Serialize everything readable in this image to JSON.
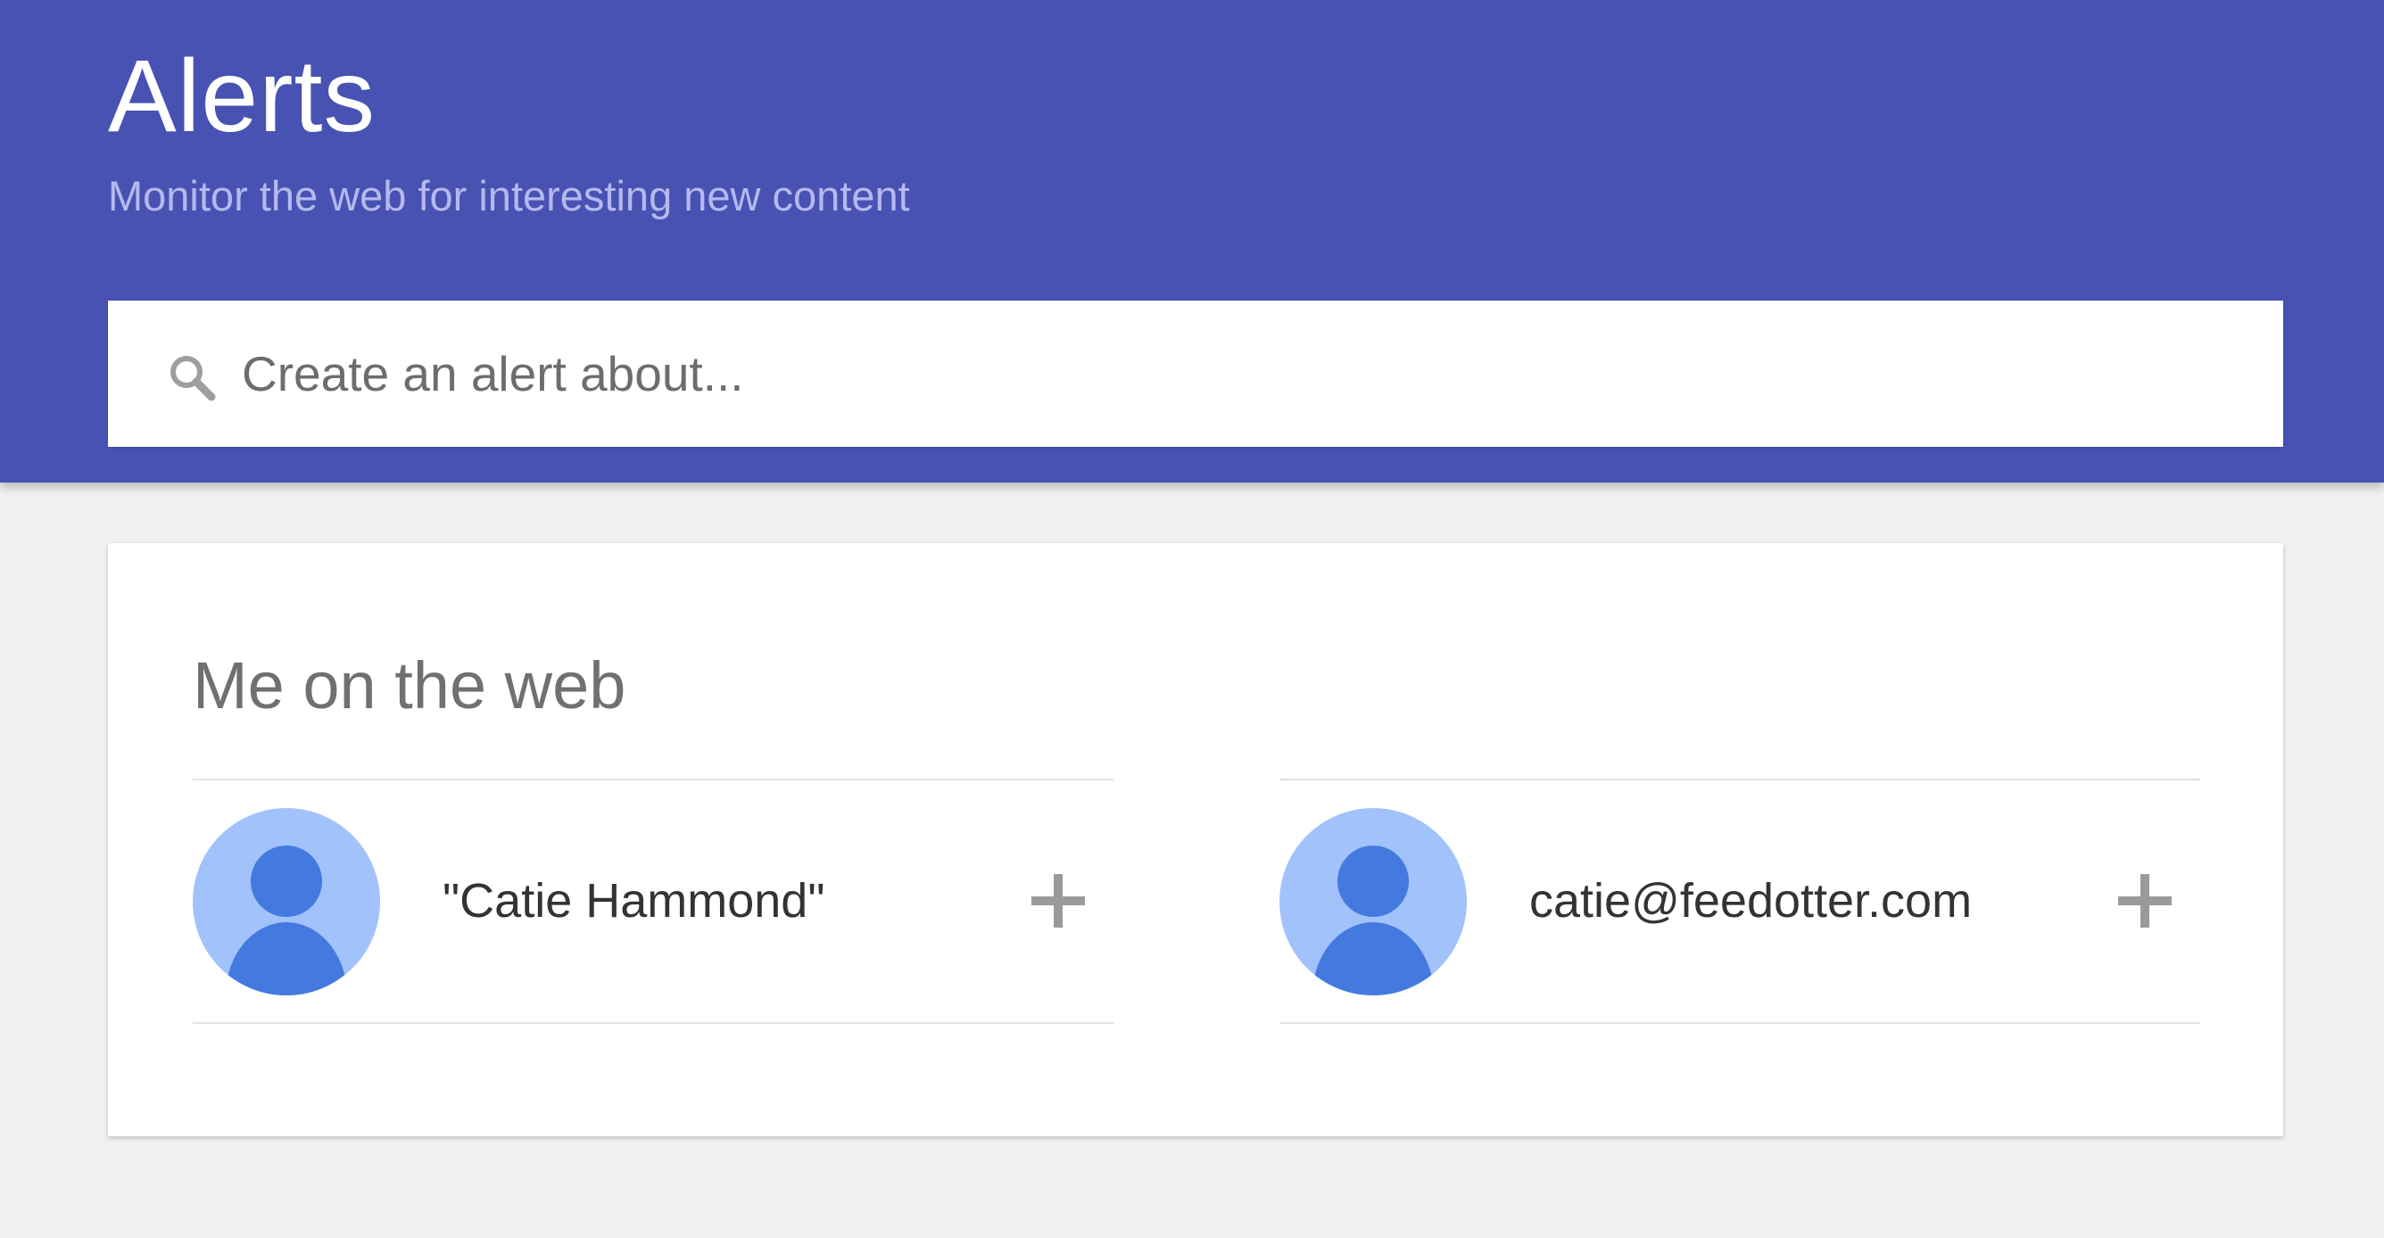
{
  "header": {
    "title": "Alerts",
    "subtitle": "Monitor the web for interesting new content",
    "background_color": "#4752b3"
  },
  "search": {
    "icon": "search-icon",
    "placeholder": "Create an alert about..."
  },
  "me_on_the_web": {
    "title": "Me on the web",
    "items": [
      {
        "label": "\"Catie Hammond\"",
        "avatar_icon": "person-avatar-icon",
        "action_icon": "add-icon"
      },
      {
        "label": "catie@feedotter.com",
        "avatar_icon": "person-avatar-icon",
        "action_icon": "add-icon"
      }
    ]
  },
  "colors": {
    "page_background": "#f1f1f1",
    "avatar_background": "#a1c2fa",
    "avatar_figure": "#4479e0",
    "add_icon": "#9a9a9a"
  }
}
